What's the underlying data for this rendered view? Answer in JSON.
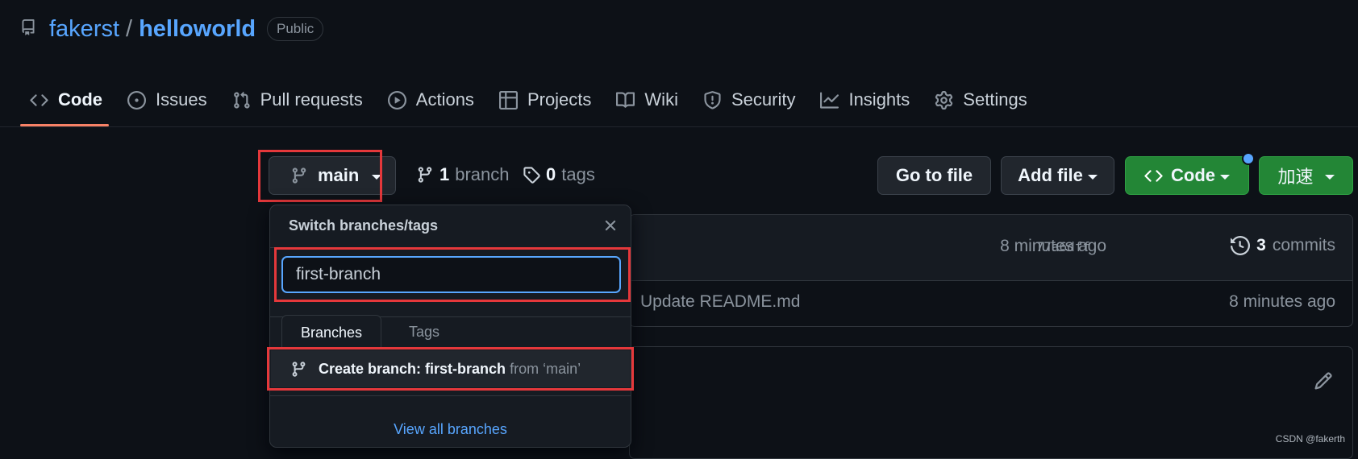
{
  "repo": {
    "owner": "fakerst",
    "separator": "/",
    "name": "helloworld",
    "visibility": "Public"
  },
  "tabs": [
    {
      "label": "Code",
      "icon": "code-icon",
      "active": true
    },
    {
      "label": "Issues",
      "icon": "issue-icon"
    },
    {
      "label": "Pull requests",
      "icon": "pull-request-icon"
    },
    {
      "label": "Actions",
      "icon": "play-icon"
    },
    {
      "label": "Projects",
      "icon": "table-icon"
    },
    {
      "label": "Wiki",
      "icon": "book-icon"
    },
    {
      "label": "Security",
      "icon": "shield-icon"
    },
    {
      "label": "Insights",
      "icon": "graph-icon"
    },
    {
      "label": "Settings",
      "icon": "gear-icon"
    }
  ],
  "branch_bar": {
    "current_branch": "main",
    "branch_count": "1",
    "branch_word": "branch",
    "tag_count": "0",
    "tag_word": "tags"
  },
  "buttons": {
    "go_to_file": "Go to file",
    "add_file": "Add file",
    "code": "Code",
    "accelerate": "加速"
  },
  "commit": {
    "hash": "77a6dff",
    "time": "8 minutes ago",
    "commit_count": "3",
    "commit_word": "commits",
    "file_message": "Update README.md",
    "file_time": "8 minutes ago"
  },
  "dropdown": {
    "title": "Switch branches/tags",
    "search_value": "first-branch",
    "tab_branches": "Branches",
    "tab_tags": "Tags",
    "create_prefix": "Create branch: first-branch",
    "create_suffix": "from ‘main’",
    "view_all": "View all branches"
  },
  "watermark": "CSDN @fakerth",
  "colors": {
    "accent": "#58a6ff",
    "green": "#238636",
    "highlight": "#e5383b",
    "tab_underline": "#f78166"
  }
}
